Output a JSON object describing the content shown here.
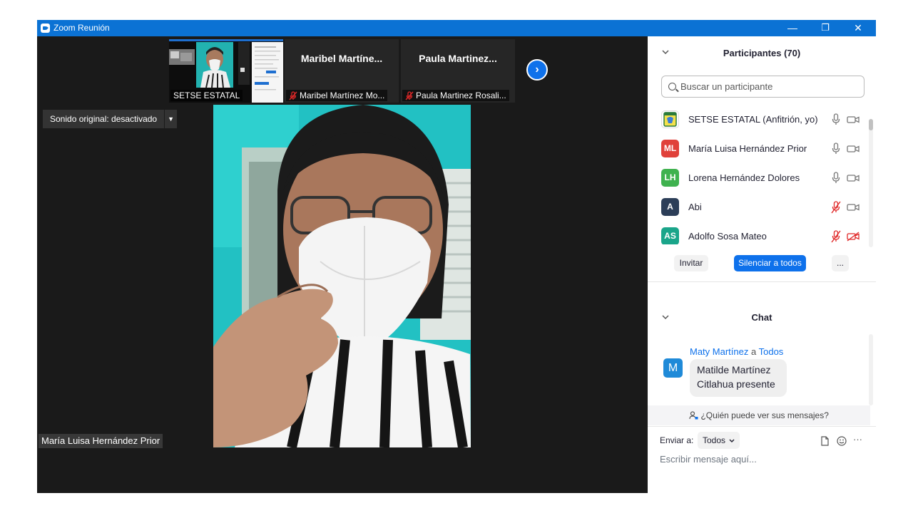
{
  "window": {
    "title": "Zoom Reunión",
    "min": "—",
    "restore": "❐",
    "close": "✕"
  },
  "stage": {
    "thumbnails": [
      {
        "label": "SETSE ESTATAL",
        "muted": false
      },
      {
        "display_name": "Maribel  Martíne...",
        "label": "Maribel Martínez Mo...",
        "muted": true
      },
      {
        "display_name": "Paula  Martinez...",
        "label": "Paula Martinez Rosali...",
        "muted": true
      }
    ],
    "sound_button": "Sonido original: desactivado",
    "active_speaker": "María Luisa Hernández Prior",
    "next_arrow": "›"
  },
  "participants": {
    "title": "Participantes (70)",
    "search_placeholder": "Buscar un participante",
    "list": [
      {
        "initials": "",
        "name": "SETSE ESTATAL (Anfitrión, yo)",
        "color": "#ffffff",
        "mic": "on",
        "cam": "on"
      },
      {
        "initials": "ML",
        "name": "María Luisa Hernández Prior",
        "color": "#e0413a",
        "mic": "on",
        "cam": "on"
      },
      {
        "initials": "LH",
        "name": "Lorena Hernández Dolores",
        "color": "#3fb24f",
        "mic": "on",
        "cam": "on"
      },
      {
        "initials": "A",
        "name": "Abi",
        "color": "#2c3e58",
        "mic": "muted",
        "cam": "on"
      },
      {
        "initials": "AS",
        "name": "Adolfo Sosa Mateo",
        "color": "#1aa58a",
        "mic": "muted",
        "cam": "off"
      }
    ],
    "invite": "Invitar",
    "mute_all": "Silenciar a todos",
    "more": "..."
  },
  "chat": {
    "title": "Chat",
    "messages": [
      {
        "avatar": "M",
        "sender": "Maty Martínez",
        "to_word": "a",
        "recipient": "Todos",
        "line1": "Matilde Martínez",
        "line2": "Citlahua presente"
      }
    ],
    "who_sees": "¿Quién puede ver sus mensajes?",
    "send_to_label": "Enviar a:",
    "send_to_value": "Todos",
    "input_placeholder": "Escribir mensaje aquí...",
    "more": "···"
  },
  "colors": {
    "titlebar": "#0b72d4",
    "accent": "#0e71eb",
    "muted_red": "#e02828"
  }
}
